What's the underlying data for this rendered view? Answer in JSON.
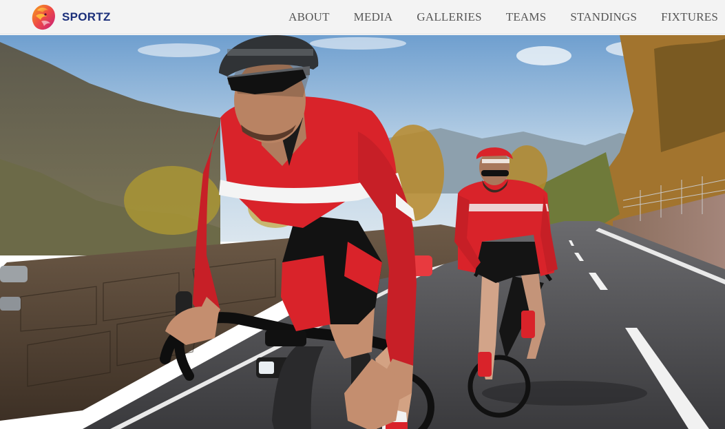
{
  "header": {
    "brand": "SPORTZ",
    "nav": [
      {
        "label": "ABOUT"
      },
      {
        "label": "MEDIA"
      },
      {
        "label": "GALLERIES"
      },
      {
        "label": "TEAMS"
      },
      {
        "label": "STANDINGS"
      },
      {
        "label": "FIXTURES"
      }
    ]
  },
  "colors": {
    "brand_text": "#1b2f7a",
    "nav_text": "#555555",
    "header_bg": "#f3f3f3",
    "jersey_red": "#d9232a"
  },
  "hero": {
    "icon": "cyclists-photo"
  }
}
